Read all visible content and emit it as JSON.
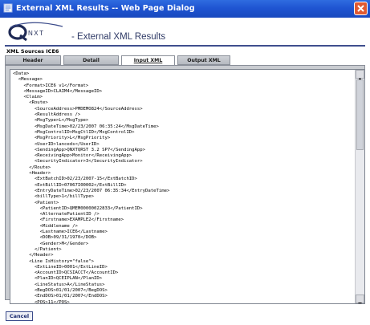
{
  "window": {
    "title": "External XML Results -- Web Page Dialog"
  },
  "header": {
    "logo_text": "QNXT",
    "page_title": "- External XML Results"
  },
  "source_label": "XML Sources ICE6",
  "tabs": [
    {
      "label": "Header",
      "active": false
    },
    {
      "label": "Detail",
      "active": false
    },
    {
      "label": "Input XML",
      "active": true
    },
    {
      "label": "Output XML",
      "active": false
    }
  ],
  "xml_lines": [
    "<Data>",
    "  <Message>",
    "    <Format>ICE6 v1</Format>",
    "    <MessageID>CLAIM4</MessageID>",
    "    <Claim>",
    "      <Route>",
    "        <SourceAddress>PMDEMO824</SourceAddress>",
    "        <ResultAddress />",
    "        <MsgType>L</MsgType>",
    "        <MsgDateTime>02/23/2007 06:35:24</MsgDateTime>",
    "        <MsgControlID>MsgCtlID</MsgControlID>",
    "        <MsgPriority>L</MsgPriority>",
    "        <UserID>lanceds</UserID>",
    "        <SendingApp>QNXTQRST 3.2 SP7</SendingApp>",
    "        <ReceivingApp>Monitor</ReceivingApp>",
    "        <SecurityIndicator>3</SecurityIndicator>",
    "      </Route>",
    "      <Header>",
    "        <ExtBatchID>02/23/2007-15</ExtBatchID>",
    "        <ExtBillID>07067I00002</ExtBillID>",
    "        <EntryDateTime>02/23/2007 06:35:34</EntryDateTime>",
    "        <billType>1</billType>",
    "        <Patient>",
    "          <PatientID>QMEM00000022833</PatientID>",
    "          <AlternatePatientID />",
    "          <Firstname>EXAMPLE2</Firstname>",
    "          <Middlename />",
    "          <Lastname>ICE6</Lastname>",
    "          <DOB>09/31/1970</DOB>",
    "          <Gender>M</Gender>",
    "        </Patient>",
    "      </Header>",
    "      <Line IsHistory=\"false\">",
    "        <ExtLineID>0001</ExtLineID>",
    "        <AccountID>QCSIACCT</AccountID>",
    "        <PlanID>QCEIPLAN</PlanID>",
    "        <LineStatus>A</LineStatus>",
    "        <BegDOS>01/01/2007</BegDOS>",
    "        <EndDOS>01/01/2007</EndDOS>",
    "        <POS>11</POS>"
  ],
  "cancel_label": "Cancel",
  "colors": {
    "titlebar": "#1f55d2",
    "title_text": "#2f3a66",
    "panel": "#c9ccd1",
    "close_button": "#e05a32"
  }
}
